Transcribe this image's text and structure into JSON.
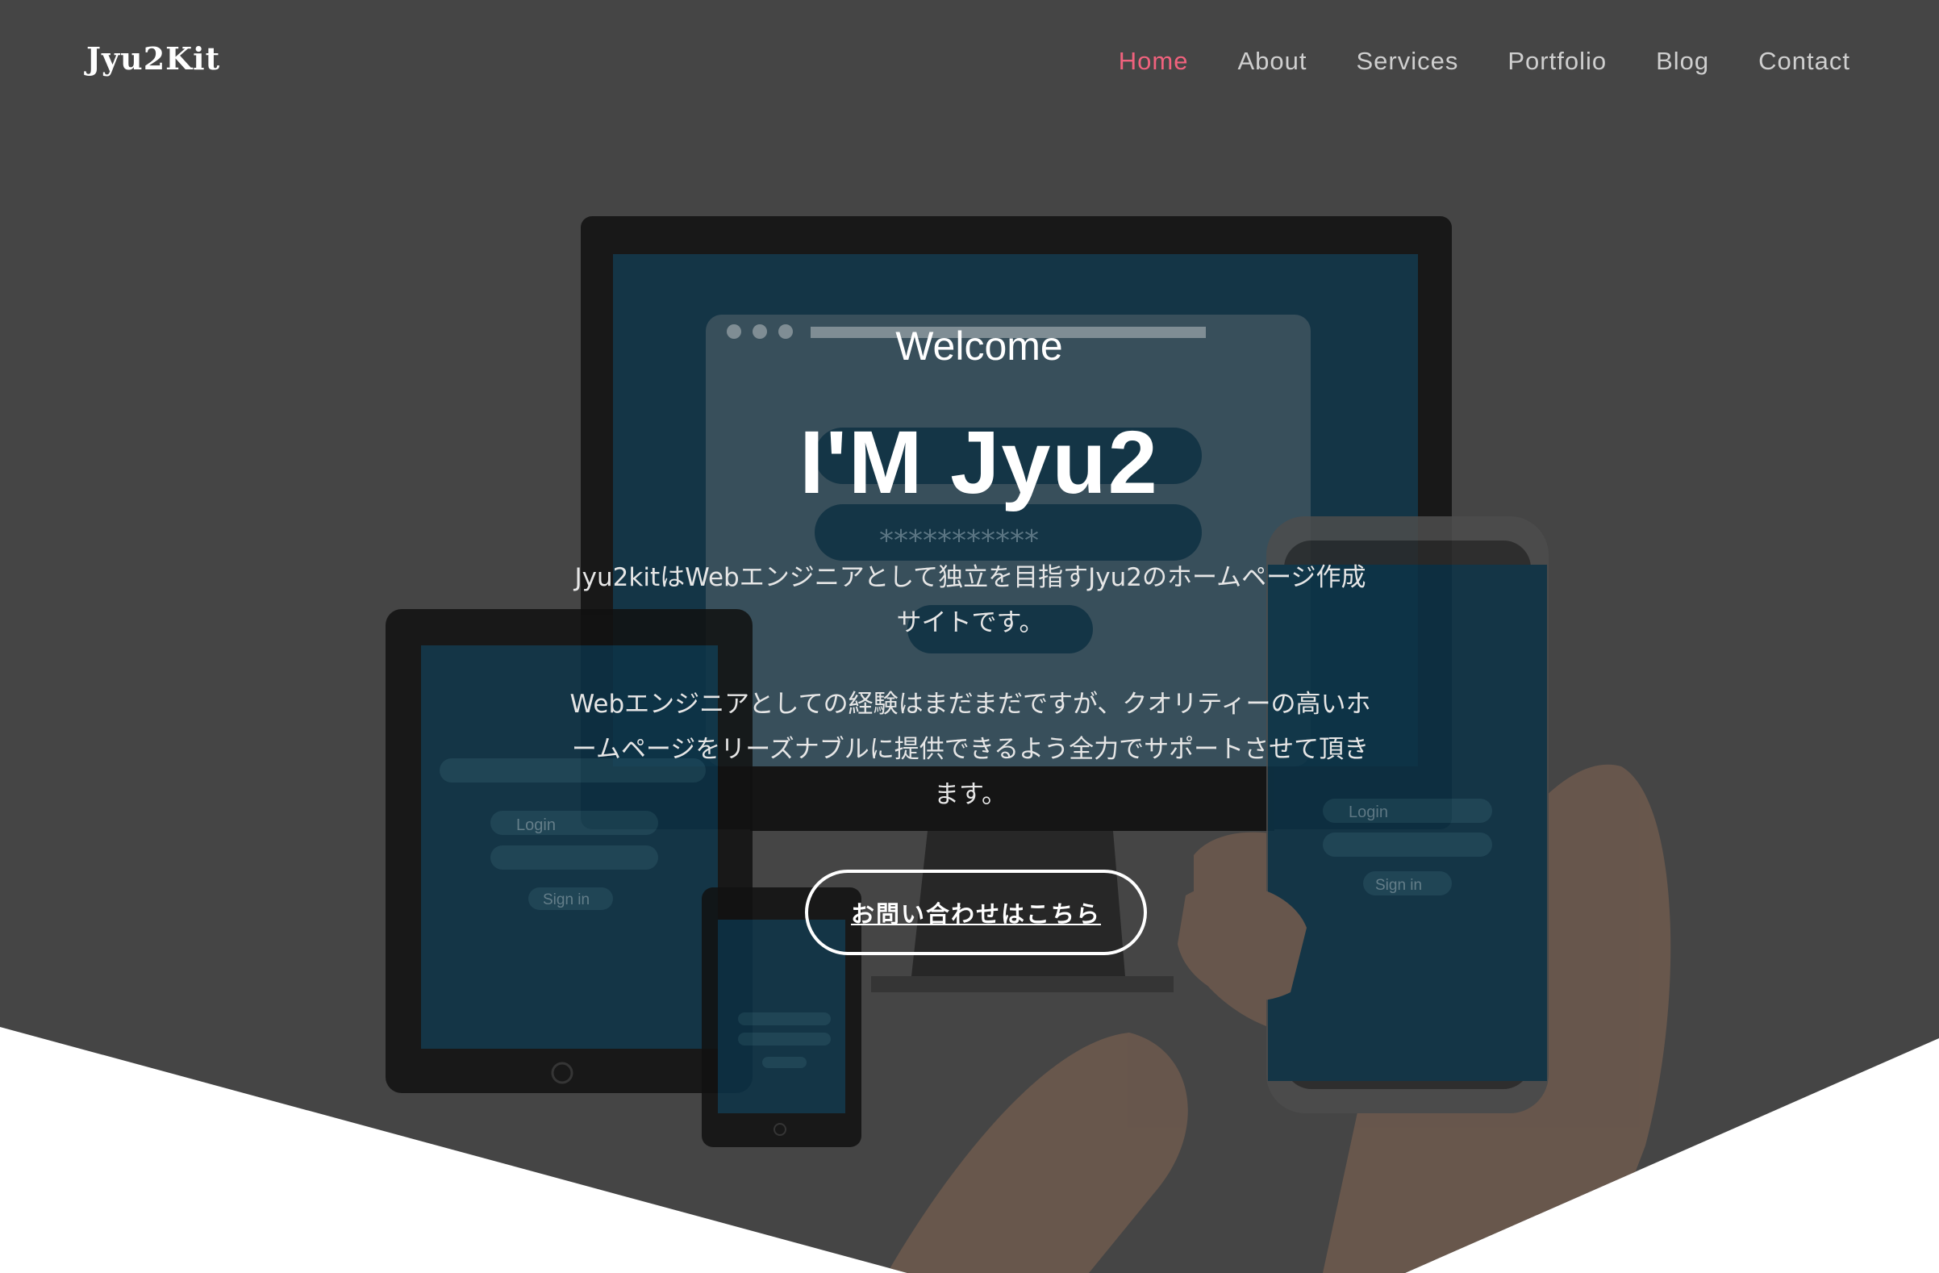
{
  "brand": "Jyu2Kit",
  "nav": {
    "items": [
      "Home",
      "About",
      "Services",
      "Portfolio",
      "Blog",
      "Contact"
    ],
    "active": "Home"
  },
  "hero": {
    "welcome": "Welcome",
    "headline": "I'M Jyu2",
    "intro": "Jyu2kitはWebエンジニアとして独立を目指すJyu2のホームページ作成サイトです。",
    "description": "Webエンジニアとしての経験はまだまだですが、クオリティーの高いホームページをリーズナブルに提供できるよう全力でサポートさせて頂きます。",
    "cta_label": "お問い合わせはこちら"
  },
  "background_mockup": {
    "login_label": "Login",
    "password_mask": "***********",
    "signin_label": "Sign in"
  },
  "colors": {
    "hero_overlay": "#454545",
    "nav_active": "#f0627d",
    "nav_text": "#cfcfcf",
    "page_bg": "#ffffff"
  }
}
